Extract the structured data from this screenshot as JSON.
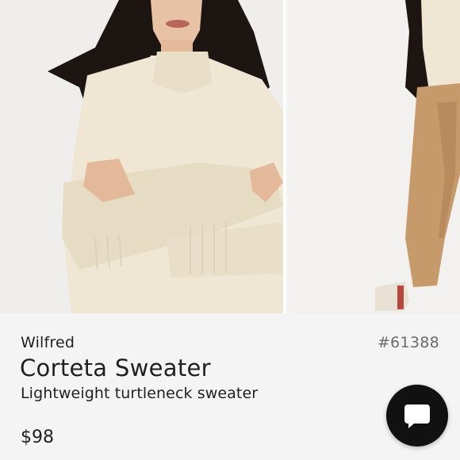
{
  "gallery": {
    "images": [
      {
        "alt": "Model wearing cream sweater, front view"
      },
      {
        "alt": "Model wearing sweater with tan trousers"
      }
    ]
  },
  "product": {
    "brand": "Wilfred",
    "sku": "#61388",
    "title": "Corteta Sweater",
    "subtitle": "Lightweight turtleneck sweater",
    "price": "$98"
  },
  "chat": {
    "icon": "chat-bubble-icon"
  },
  "colors": {
    "background": "#f4f4f4",
    "text": "#1f1f1f",
    "muted": "#6b6b6b",
    "chat_button": "#111111",
    "sweater": "#efe7d3",
    "trousers": "#c69a6b"
  }
}
